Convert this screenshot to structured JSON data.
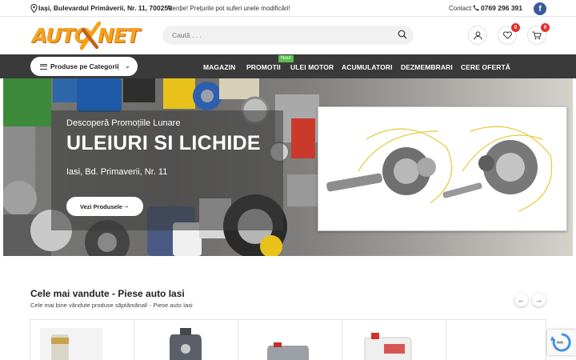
{
  "topbar": {
    "address": "Iași, Bulevardul Primăverii, Nr. 11, 700259",
    "notice": "Atenție! Prețurile pot suferi unele modificări!",
    "contact_label": "Contact:",
    "phone": "0769 296 391",
    "social": "f"
  },
  "header": {
    "logo_left": "AUTO",
    "logo_right": "NET",
    "search_placeholder": "Caută . . .",
    "wishlist_count": "0",
    "cart_count": "0"
  },
  "nav": {
    "categories_label": "Produse pe Categorii",
    "items": [
      "MAGAZIN",
      "PROMOTII",
      "ULEI MOTOR",
      "ACUMULATORI",
      "DEZMEMBRARI",
      "CERE OFERTĂ"
    ],
    "new_badge": "Nou!"
  },
  "hero": {
    "promo": "Descoperă Promoțiile Lunare",
    "title": "ULEIURI SI LICHIDE",
    "location": "Iasi, Bd. Primaverii, Nr. 11",
    "cta": "Vezi Produsele"
  },
  "bestsellers": {
    "title": "Cele mai vandute - Piese auto Iasi",
    "subtitle": "Cele mai bine vândute produse săptămânal! - Piese auto Iasi"
  },
  "colors": {
    "accent": "#f6a21b",
    "nav_bg": "#3a3a3a",
    "badge_red": "#e2302a",
    "badge_green": "#5bbd4d",
    "facebook": "#3b5998"
  }
}
